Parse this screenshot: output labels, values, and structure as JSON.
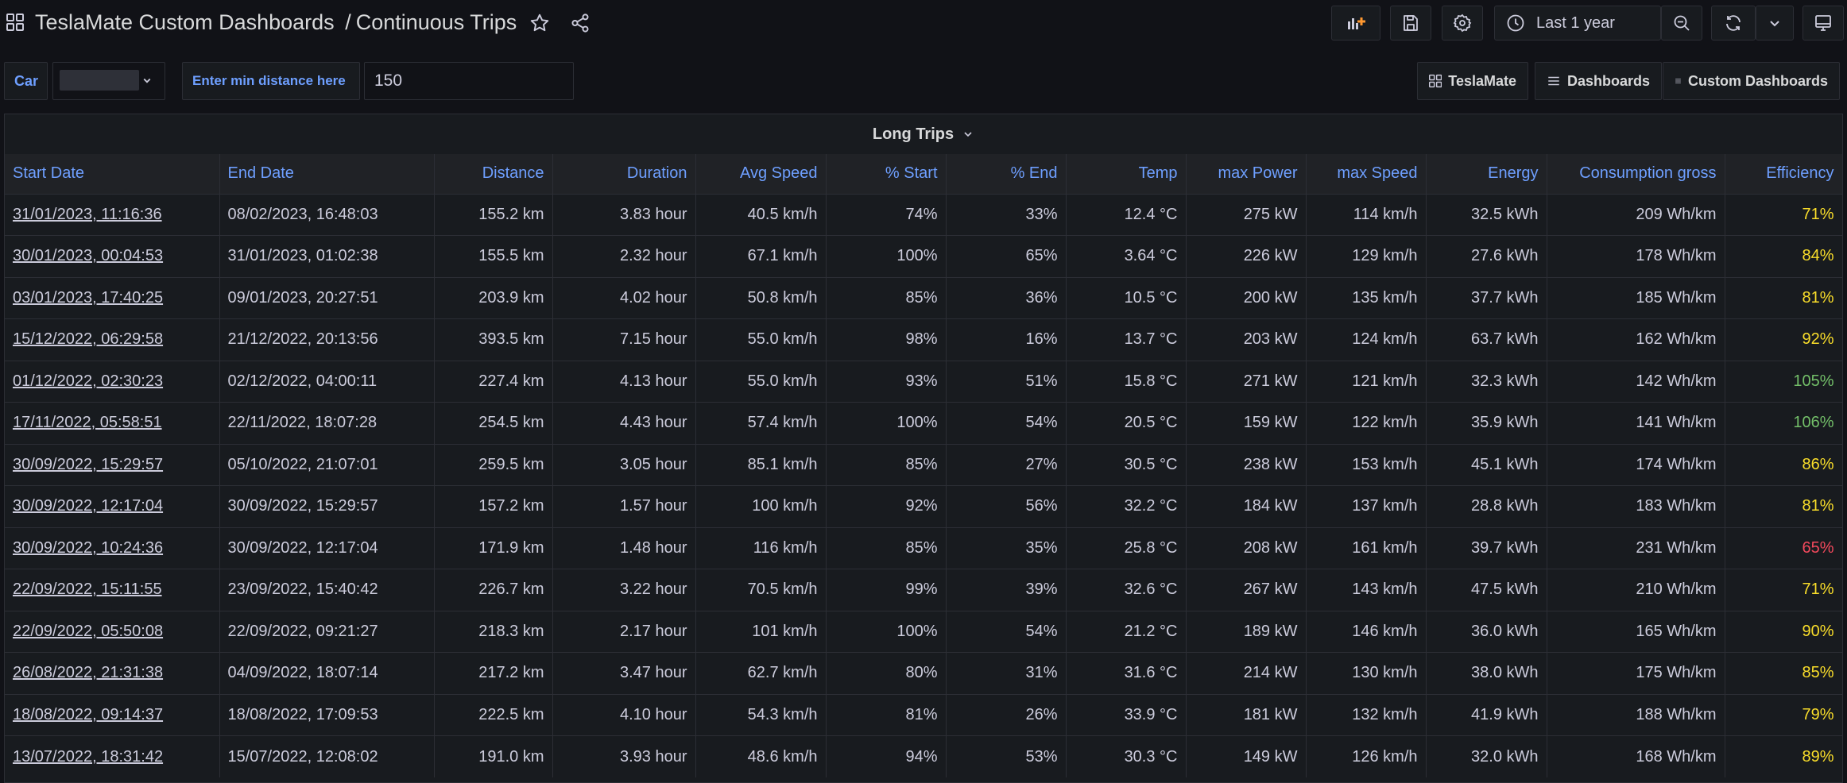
{
  "header": {
    "folder": "TeslaMate Custom Dashboards",
    "separator": "/",
    "dashboard": "Continuous Trips"
  },
  "toolbar": {
    "time_range": "Last 1 year"
  },
  "variables": {
    "car_label": "Car",
    "min_distance_label": "Enter min distance here",
    "min_distance_value": "150"
  },
  "links": {
    "teslamate": "TeslaMate",
    "dashboards": "Dashboards",
    "custom_dashboards": "Custom Dashboards"
  },
  "panel": {
    "title": "Long Trips",
    "columns": [
      "Start Date",
      "End Date",
      "Distance",
      "Duration",
      "Avg Speed",
      "% Start",
      "% End",
      "Temp",
      "max Power",
      "max Speed",
      "Energy",
      "Consumption gross",
      "Efficiency"
    ],
    "rows": [
      [
        "31/01/2023, 11:16:36",
        "08/02/2023, 16:48:03",
        "155.2 km",
        "3.83 hour",
        "40.5 km/h",
        "74%",
        "33%",
        "12.4 °C",
        "275 kW",
        "114 km/h",
        "32.5 kWh",
        "209 Wh/km",
        "71%"
      ],
      [
        "30/01/2023, 00:04:53",
        "31/01/2023, 01:02:38",
        "155.5 km",
        "2.32 hour",
        "67.1 km/h",
        "100%",
        "65%",
        "3.64 °C",
        "226 kW",
        "129 km/h",
        "27.6 kWh",
        "178 Wh/km",
        "84%"
      ],
      [
        "03/01/2023, 17:40:25",
        "09/01/2023, 20:27:51",
        "203.9 km",
        "4.02 hour",
        "50.8 km/h",
        "85%",
        "36%",
        "10.5 °C",
        "200 kW",
        "135 km/h",
        "37.7 kWh",
        "185 Wh/km",
        "81%"
      ],
      [
        "15/12/2022, 06:29:58",
        "21/12/2022, 20:13:56",
        "393.5 km",
        "7.15 hour",
        "55.0 km/h",
        "98%",
        "16%",
        "13.7 °C",
        "203 kW",
        "124 km/h",
        "63.7 kWh",
        "162 Wh/km",
        "92%"
      ],
      [
        "01/12/2022, 02:30:23",
        "02/12/2022, 04:00:11",
        "227.4 km",
        "4.13 hour",
        "55.0 km/h",
        "93%",
        "51%",
        "15.8 °C",
        "271 kW",
        "121 km/h",
        "32.3 kWh",
        "142 Wh/km",
        "105%"
      ],
      [
        "17/11/2022, 05:58:51",
        "22/11/2022, 18:07:28",
        "254.5 km",
        "4.43 hour",
        "57.4 km/h",
        "100%",
        "54%",
        "20.5 °C",
        "159 kW",
        "122 km/h",
        "35.9 kWh",
        "141 Wh/km",
        "106%"
      ],
      [
        "30/09/2022, 15:29:57",
        "05/10/2022, 21:07:01",
        "259.5 km",
        "3.05 hour",
        "85.1 km/h",
        "85%",
        "27%",
        "30.5 °C",
        "238 kW",
        "153 km/h",
        "45.1 kWh",
        "174 Wh/km",
        "86%"
      ],
      [
        "30/09/2022, 12:17:04",
        "30/09/2022, 15:29:57",
        "157.2 km",
        "1.57 hour",
        "100 km/h",
        "92%",
        "56%",
        "32.2 °C",
        "184 kW",
        "137 km/h",
        "28.8 kWh",
        "183 Wh/km",
        "81%"
      ],
      [
        "30/09/2022, 10:24:36",
        "30/09/2022, 12:17:04",
        "171.9 km",
        "1.48 hour",
        "116 km/h",
        "85%",
        "35%",
        "25.8 °C",
        "208 kW",
        "161 km/h",
        "39.7 kWh",
        "231 Wh/km",
        "65%"
      ],
      [
        "22/09/2022, 15:11:55",
        "23/09/2022, 15:40:42",
        "226.7 km",
        "3.22 hour",
        "70.5 km/h",
        "99%",
        "39%",
        "32.6 °C",
        "267 kW",
        "143 km/h",
        "47.5 kWh",
        "210 Wh/km",
        "71%"
      ],
      [
        "22/09/2022, 05:50:08",
        "22/09/2022, 09:21:27",
        "218.3 km",
        "2.17 hour",
        "101 km/h",
        "100%",
        "54%",
        "21.2 °C",
        "189 kW",
        "146 km/h",
        "36.0 kWh",
        "165 Wh/km",
        "90%"
      ],
      [
        "26/08/2022, 21:31:38",
        "04/09/2022, 18:07:14",
        "217.2 km",
        "3.47 hour",
        "62.7 km/h",
        "80%",
        "31%",
        "31.6 °C",
        "214 kW",
        "130 km/h",
        "38.0 kWh",
        "175 Wh/km",
        "85%"
      ],
      [
        "18/08/2022, 09:14:37",
        "18/08/2022, 17:09:53",
        "222.5 km",
        "4.10 hour",
        "54.3 km/h",
        "81%",
        "26%",
        "33.9 °C",
        "181 kW",
        "132 km/h",
        "41.9 kWh",
        "188 Wh/km",
        "79%"
      ],
      [
        "13/07/2022, 18:31:42",
        "15/07/2022, 12:08:02",
        "191.0 km",
        "3.93 hour",
        "48.6 km/h",
        "94%",
        "53%",
        "30.3 °C",
        "149 kW",
        "126 km/h",
        "32.0 kWh",
        "168 Wh/km",
        "89%"
      ]
    ],
    "efficiency_colors": {
      "yellow": "#fade2a",
      "green": "#73bf69",
      "red": "#f2495c"
    },
    "efficiency_row_colors": [
      "yellow",
      "yellow",
      "yellow",
      "yellow",
      "green",
      "green",
      "yellow",
      "yellow",
      "red",
      "yellow",
      "yellow",
      "yellow",
      "yellow",
      "yellow"
    ]
  }
}
